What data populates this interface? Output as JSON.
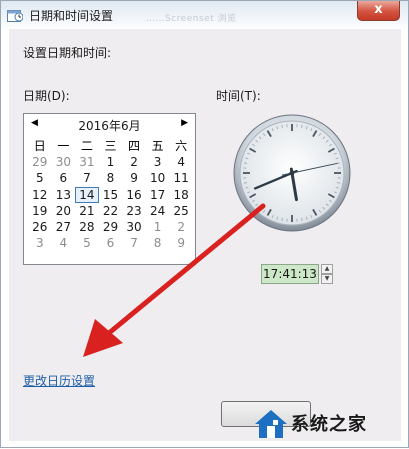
{
  "window": {
    "title": "日期和时间设置",
    "title_faded": "……Screenset 浏览",
    "close_label": "x"
  },
  "heading": "设置日期和时间:",
  "date_label": "日期(D):",
  "time_label": "时间(T):",
  "calendar": {
    "month_title": "2016年6月",
    "prev_label": "◀",
    "next_label": "▶",
    "weekdays": [
      "日",
      "一",
      "二",
      "三",
      "四",
      "五",
      "六"
    ],
    "weeks": [
      [
        "29",
        "30",
        "31",
        "1",
        "2",
        "3",
        "4"
      ],
      [
        "5",
        "6",
        "7",
        "8",
        "9",
        "10",
        "11"
      ],
      [
        "12",
        "13",
        "14",
        "15",
        "16",
        "17",
        "18"
      ],
      [
        "19",
        "20",
        "21",
        "22",
        "23",
        "24",
        "25"
      ],
      [
        "26",
        "27",
        "28",
        "29",
        "30",
        "1",
        "2"
      ],
      [
        "3",
        "4",
        "5",
        "6",
        "7",
        "8",
        "9"
      ]
    ],
    "selected_day": "14"
  },
  "clock": {
    "hours": 17,
    "minutes": 41,
    "seconds": 13
  },
  "time_value": "17:41:13",
  "change_calendar_link": "更改日历设置",
  "watermark": {
    "text": "系统之家"
  },
  "colors": {
    "arrow": "#d9221f",
    "link": "#1f5fa8",
    "time_box": "#cde8c8"
  }
}
